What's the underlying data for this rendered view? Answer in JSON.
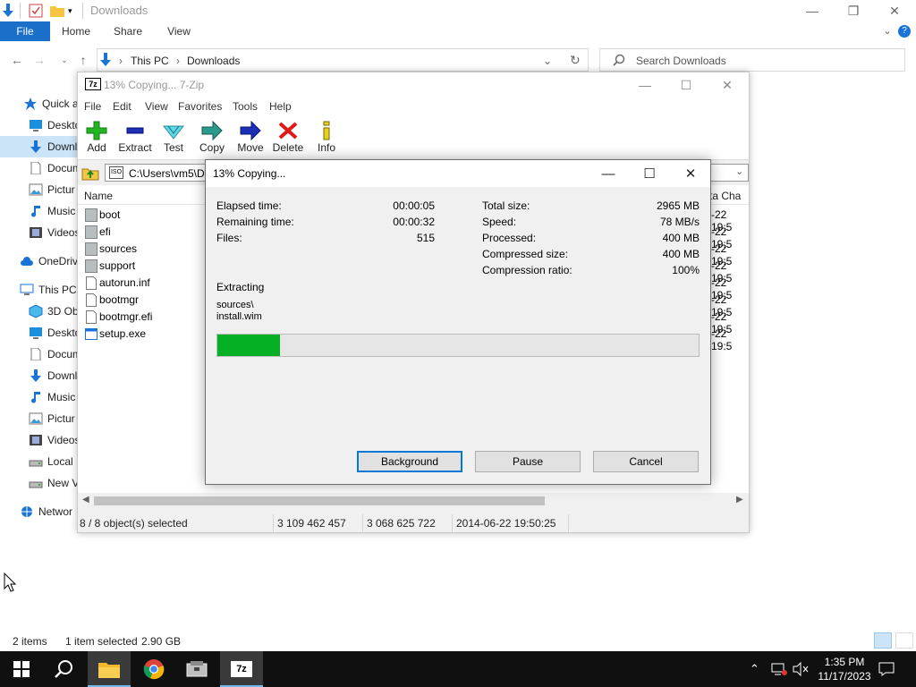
{
  "explorer": {
    "title": "Downloads",
    "ribbon_tabs": [
      "File",
      "Home",
      "Share",
      "View"
    ],
    "address": {
      "segments": [
        "This PC",
        "Downloads"
      ]
    },
    "search_placeholder": "Search Downloads",
    "nav_items": [
      {
        "label": "Quick a",
        "icon": "star-icon"
      },
      {
        "label": "Deskto",
        "icon": "desktop-icon"
      },
      {
        "label": "Downl",
        "icon": "download-icon",
        "selected": true
      },
      {
        "label": "Docum",
        "icon": "document-icon"
      },
      {
        "label": "Pictur",
        "icon": "pictures-icon"
      },
      {
        "label": "Music",
        "icon": "music-icon"
      },
      {
        "label": "Videos",
        "icon": "video-icon"
      },
      {
        "label": "OneDriv",
        "icon": "cloud-icon"
      },
      {
        "label": "This PC",
        "icon": "computer-icon"
      },
      {
        "label": "3D Ob",
        "icon": "cube-icon"
      },
      {
        "label": "Deskto",
        "icon": "desktop-icon"
      },
      {
        "label": "Docum",
        "icon": "document-icon"
      },
      {
        "label": "Downl",
        "icon": "download-icon"
      },
      {
        "label": "Music",
        "icon": "music-icon"
      },
      {
        "label": "Pictur",
        "icon": "pictures-icon"
      },
      {
        "label": "Videos",
        "icon": "video-icon"
      },
      {
        "label": "Local I",
        "icon": "drive-icon"
      },
      {
        "label": "New V",
        "icon": "drive-icon"
      },
      {
        "label": "Networ",
        "icon": "network-icon"
      }
    ],
    "status": {
      "items": "2 items",
      "selected": "1 item selected",
      "size": "2.90 GB"
    }
  },
  "zip": {
    "title": "13% Copying... 7-Zip",
    "logo_text": "7z",
    "menu": [
      "File",
      "Edit",
      "View",
      "Favorites",
      "Tools",
      "Help"
    ],
    "toolbar": [
      {
        "label": "Add",
        "icon": "plus-icon"
      },
      {
        "label": "Extract",
        "icon": "minus-icon"
      },
      {
        "label": "Test",
        "icon": "check-icon"
      },
      {
        "label": "Copy",
        "icon": "arrow-right-icon"
      },
      {
        "label": "Move",
        "icon": "arrow-right-icon"
      },
      {
        "label": "Delete",
        "icon": "x-icon"
      },
      {
        "label": "Info",
        "icon": "info-icon"
      }
    ],
    "path": "C:\\Users\\vm5\\Do",
    "columns": {
      "name": "Name",
      "date": "ta Cha"
    },
    "files": [
      {
        "name": "boot",
        "type": "folder",
        "date": "-22 19:5"
      },
      {
        "name": "efi",
        "type": "folder",
        "date": "-22 19:5"
      },
      {
        "name": "sources",
        "type": "folder",
        "date": "-22 19:5"
      },
      {
        "name": "support",
        "type": "folder",
        "date": "-22 19:5"
      },
      {
        "name": "autorun.inf",
        "type": "file",
        "date": "-22 19:5"
      },
      {
        "name": "bootmgr",
        "type": "file",
        "date": "-22 19:5"
      },
      {
        "name": "bootmgr.efi",
        "type": "file",
        "date": "-22 19:5"
      },
      {
        "name": "setup.exe",
        "type": "exe",
        "date": "-22 19:5"
      }
    ],
    "status": {
      "selected": "8 / 8 object(s) selected",
      "size": "3 109 462 457",
      "packed": "3 068 625 722",
      "modified": "2014-06-22 19:50:25"
    }
  },
  "progress": {
    "title": "13% Copying...",
    "left": [
      {
        "label": "Elapsed time:",
        "value": "00:00:05"
      },
      {
        "label": "Remaining time:",
        "value": "00:00:32"
      },
      {
        "label": "Files:",
        "value": "515"
      }
    ],
    "right": [
      {
        "label": "Total size:",
        "value": "2965 MB"
      },
      {
        "label": "Speed:",
        "value": "78 MB/s"
      },
      {
        "label": "Processed:",
        "value": "400 MB"
      },
      {
        "label": "Compressed size:",
        "value": "400 MB"
      },
      {
        "label": "Compression ratio:",
        "value": "100%"
      }
    ],
    "operation": "Extracting",
    "current_path": "sources\\",
    "current_file": "install.wim",
    "percent": 13,
    "buttons": {
      "background": "Background",
      "pause": "Pause",
      "cancel": "Cancel"
    }
  },
  "taskbar": {
    "apps": [
      "start-icon",
      "search-icon",
      "file-explorer-icon",
      "chrome-icon",
      "archive-app-icon",
      "7zip-icon"
    ],
    "time": "1:35 PM",
    "date": "11/17/2023"
  },
  "colors": {
    "progress_fill": "#06b025",
    "ribbon_file": "#1a6fc9",
    "taskbar": "#101010",
    "selection": "#cce4f7"
  }
}
